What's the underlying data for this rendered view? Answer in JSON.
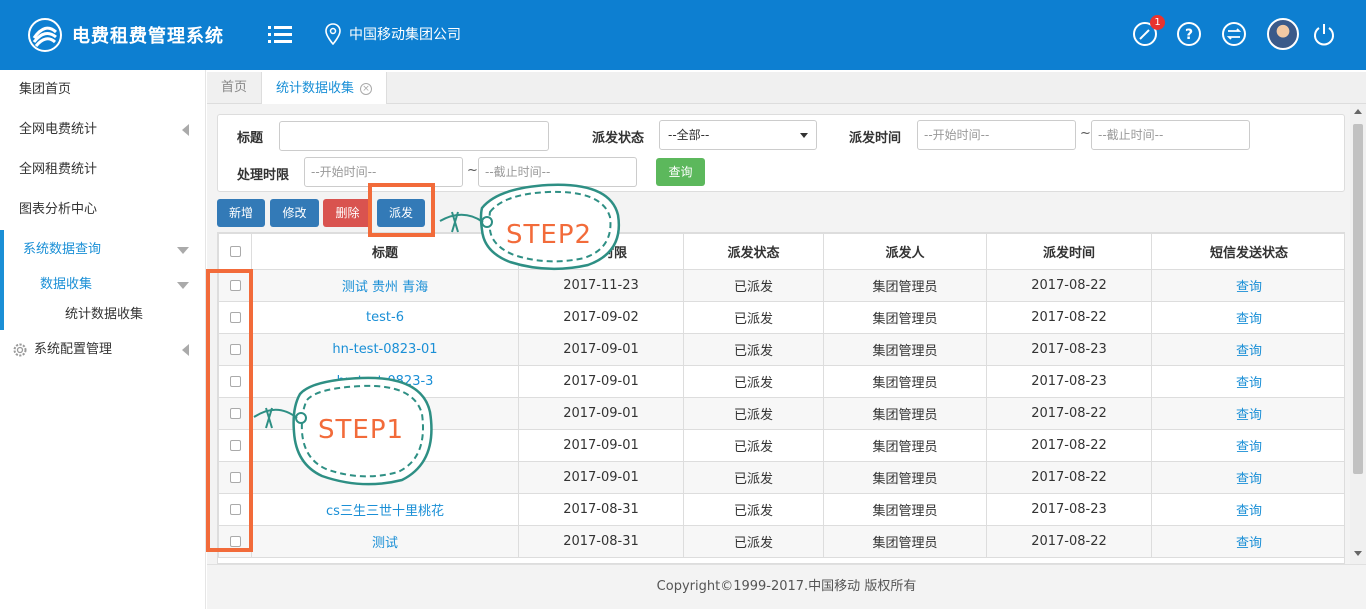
{
  "header": {
    "app_title": "电费租费管理系统",
    "company": "中国移动集团公司",
    "notification_count": "1"
  },
  "sidebar": {
    "items": [
      {
        "label": "集团首页"
      },
      {
        "label": "全网电费统计"
      },
      {
        "label": "全网租费统计"
      },
      {
        "label": "图表分析中心"
      },
      {
        "label": "系统数据查询"
      }
    ],
    "sub_label": "数据收集",
    "subsub_label": "统计数据收集",
    "config_label": "系统配置管理"
  },
  "tabs": [
    {
      "label": "首页"
    },
    {
      "label": "统计数据收集"
    }
  ],
  "filters": {
    "title_label": "标题",
    "title_value": "",
    "status_label": "派发状态",
    "status_value": "--全部--",
    "dispatch_time_label": "派发时间",
    "start_placeholder": "--开始时间--",
    "end_placeholder": "--截止时间--",
    "deadline_label": "处理时限",
    "tilde": "~",
    "search_label": "查询"
  },
  "toolbar": {
    "add_label": "新增",
    "edit_label": "修改",
    "delete_label": "删除",
    "dispatch_label": "派发"
  },
  "table": {
    "headers": [
      "标题",
      "处理时限",
      "派发状态",
      "派发人",
      "派发时间",
      "短信发送状态"
    ],
    "rows": [
      {
        "title": "测试 贵州 青海",
        "deadline": "2017-11-23",
        "status": "已派发",
        "dispatcher": "集团管理员",
        "time": "2017-08-22",
        "sms": "查询"
      },
      {
        "title": "test-6",
        "deadline": "2017-09-02",
        "status": "已派发",
        "dispatcher": "集团管理员",
        "time": "2017-08-22",
        "sms": "查询"
      },
      {
        "title": "hn-test-0823-01",
        "deadline": "2017-09-01",
        "status": "已派发",
        "dispatcher": "集团管理员",
        "time": "2017-08-23",
        "sms": "查询"
      },
      {
        "title": "hn-test-0823-3",
        "deadline": "2017-09-01",
        "status": "已派发",
        "dispatcher": "集团管理员",
        "time": "2017-08-23",
        "sms": "查询"
      },
      {
        "title": "",
        "deadline": "2017-09-01",
        "status": "已派发",
        "dispatcher": "集团管理员",
        "time": "2017-08-22",
        "sms": "查询"
      },
      {
        "title": "",
        "deadline": "2017-09-01",
        "status": "已派发",
        "dispatcher": "集团管理员",
        "time": "2017-08-22",
        "sms": "查询"
      },
      {
        "title": "",
        "deadline": "2017-09-01",
        "status": "已派发",
        "dispatcher": "集团管理员",
        "time": "2017-08-22",
        "sms": "查询"
      },
      {
        "title": "cs三生三世十里桃花",
        "deadline": "2017-08-31",
        "status": "已派发",
        "dispatcher": "集团管理员",
        "time": "2017-08-23",
        "sms": "查询"
      },
      {
        "title": "测试",
        "deadline": "2017-08-31",
        "status": "已派发",
        "dispatcher": "集团管理员",
        "time": "2017-08-22",
        "sms": "查询"
      }
    ]
  },
  "annotations": {
    "step1": "STEP1",
    "step2": "STEP2",
    "color": "#f26b3a",
    "tag_color": "#2e8f84"
  },
  "footer": {
    "copyright": "Copyright©1999-2017.中国移动 版权所有"
  },
  "colors": {
    "header_bg": "#0d7fd1",
    "accent": "#1a8fd6"
  }
}
